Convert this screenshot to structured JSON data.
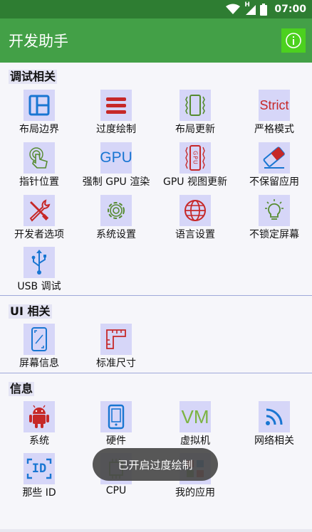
{
  "status_bar": {
    "time": "07:00",
    "network_indicator": "H"
  },
  "app_bar": {
    "title": "开发助手",
    "info_icon": "info-circle-icon"
  },
  "sections": [
    {
      "title": "调试相关",
      "items": [
        {
          "label": "布局边界",
          "icon": "layout-bounds-icon"
        },
        {
          "label": "过度绘制",
          "icon": "overdraw-icon"
        },
        {
          "label": "布局更新",
          "icon": "layout-update-icon"
        },
        {
          "label": "严格模式",
          "icon": "strict-mode-icon",
          "icon_text": "Strict"
        },
        {
          "label": "指针位置",
          "icon": "pointer-location-icon"
        },
        {
          "label": "强制 GPU 渲染",
          "icon": "gpu-render-icon",
          "icon_text": "GPU"
        },
        {
          "label": "GPU 视图更新",
          "icon": "gpu-view-update-icon",
          "icon_text": "GPU"
        },
        {
          "label": "不保留应用",
          "icon": "eraser-icon"
        },
        {
          "label": "开发者选项",
          "icon": "developer-tools-icon"
        },
        {
          "label": "系统设置",
          "icon": "system-settings-gear-icon"
        },
        {
          "label": "语言设置",
          "icon": "language-globe-icon"
        },
        {
          "label": "不锁定屏幕",
          "icon": "lightbulb-icon"
        },
        {
          "label": "USB 调试",
          "icon": "usb-icon"
        }
      ]
    },
    {
      "title": "UI 相关",
      "items": [
        {
          "label": "屏幕信息",
          "icon": "screen-info-icon"
        },
        {
          "label": "标准尺寸",
          "icon": "ruler-icon"
        }
      ]
    },
    {
      "title": "信息",
      "items": [
        {
          "label": "系统",
          "icon": "android-robot-icon"
        },
        {
          "label": "硬件",
          "icon": "phone-hardware-icon"
        },
        {
          "label": "虚拟机",
          "icon": "vm-icon",
          "icon_text": "VM"
        },
        {
          "label": "网络相关",
          "icon": "rss-network-icon"
        },
        {
          "label": "那些 ID",
          "icon": "id-icon",
          "icon_text": "ID"
        },
        {
          "label": "CPU",
          "icon": "cpu-chip-icon"
        },
        {
          "label": "我的应用",
          "icon": "my-apps-icon"
        }
      ]
    }
  ],
  "toast": {
    "message": "已开启过度绘制"
  },
  "colors": {
    "status_bar": "#2e7d32",
    "app_bar": "#43a047",
    "info_button": "#4cd11f",
    "icon_bg": "#d6d6f8",
    "icon_blue": "#1976d2",
    "icon_red": "#c62828",
    "icon_green": "#558b2f"
  }
}
